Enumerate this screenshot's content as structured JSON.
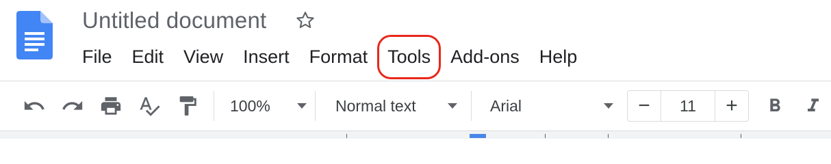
{
  "document": {
    "title": "Untitled document"
  },
  "menu": [
    "File",
    "Edit",
    "View",
    "Insert",
    "Format",
    "Tools",
    "Add-ons",
    "Help"
  ],
  "highlighted_menu": "Tools",
  "highlight_color": "#e8271b",
  "toolbar": {
    "undo_icon": "undo-icon",
    "redo_icon": "redo-icon",
    "print_icon": "print-icon",
    "spellcheck_icon": "spellcheck-icon",
    "paint_format_icon": "paint-format-icon",
    "zoom": "100%",
    "style": "Normal text",
    "font": "Arial",
    "font_size": "11",
    "decrease_label": "−",
    "increase_label": "+",
    "bold_icon": "bold-icon",
    "italic_icon": "italic-icon"
  },
  "colors": {
    "brand_blue": "#4285f4",
    "text_gray": "#5f6368"
  }
}
